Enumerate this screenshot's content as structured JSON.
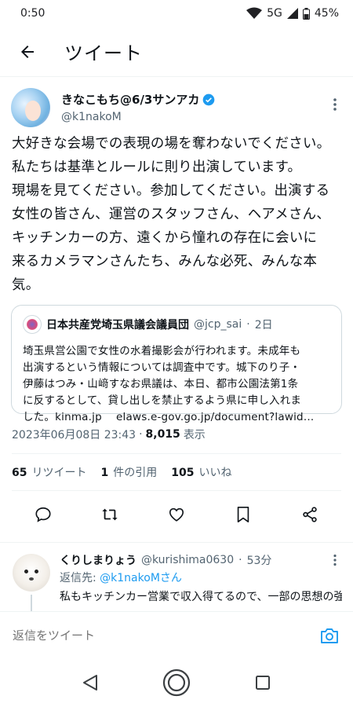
{
  "status": {
    "time": "0:50",
    "network": "5G",
    "battery": "45%"
  },
  "header": {
    "title": "ツイート"
  },
  "tweet": {
    "author": {
      "name": "きなこもち@6/3サンアカ",
      "handle": "@k1nakoM"
    },
    "text": "大好きな会場での表現の場を奪わないでください。\n私たちは基準とルールに則り出演しています。\n現場を見てください。参加してください。出演する\n女性の皆さん、運営のスタッフさん、ヘアメさん、\nキッチンカーの方、遠くから憧れの存在に会いに\n来るカメラマンさんたち、みんな必死、みんな本\n気。",
    "quote": {
      "name": "日本共産党埼玉県議会議員団",
      "handle": "@jcp_sai",
      "dot": "·",
      "time": "2日",
      "text": "埼玉県営公園で女性の水着撮影会が行われます。未成年も\n出演するという情報については調査中です。城下のり子・\n伊藤はつみ・山﨑すなお県議は、本日、都市公園法第1条\nに反するとして、貸し出しを禁止するよう県に申し入れま\nした。kinma.jp　 elaws.e-gov.go.jp/document?lawid…"
    },
    "timestamp": "2023年06月08日 23:43",
    "separator": "·",
    "views": "8,015",
    "views_label": "表示",
    "stats": {
      "retweets": "65",
      "retweets_label": "リツイート",
      "quotes": "1",
      "quotes_label": "件の引用",
      "likes": "105",
      "likes_label": "いいね"
    }
  },
  "reply": {
    "name": "くりしまりょう",
    "handle": "@kurishima0630",
    "dot": "·",
    "time": "53分",
    "reply_to_label": "返信先:",
    "reply_to": "@k1nakoMさん",
    "text": "私もキッチンカー営業で収入得てるので、一部の思想の強い人間のせいでイベントが潰されるのは本当にキ"
  },
  "compose": {
    "placeholder": "返信をツイート"
  },
  "colors": {
    "accent": "#1d9bf0",
    "text": "#0f1419",
    "secondary": "#536471"
  }
}
